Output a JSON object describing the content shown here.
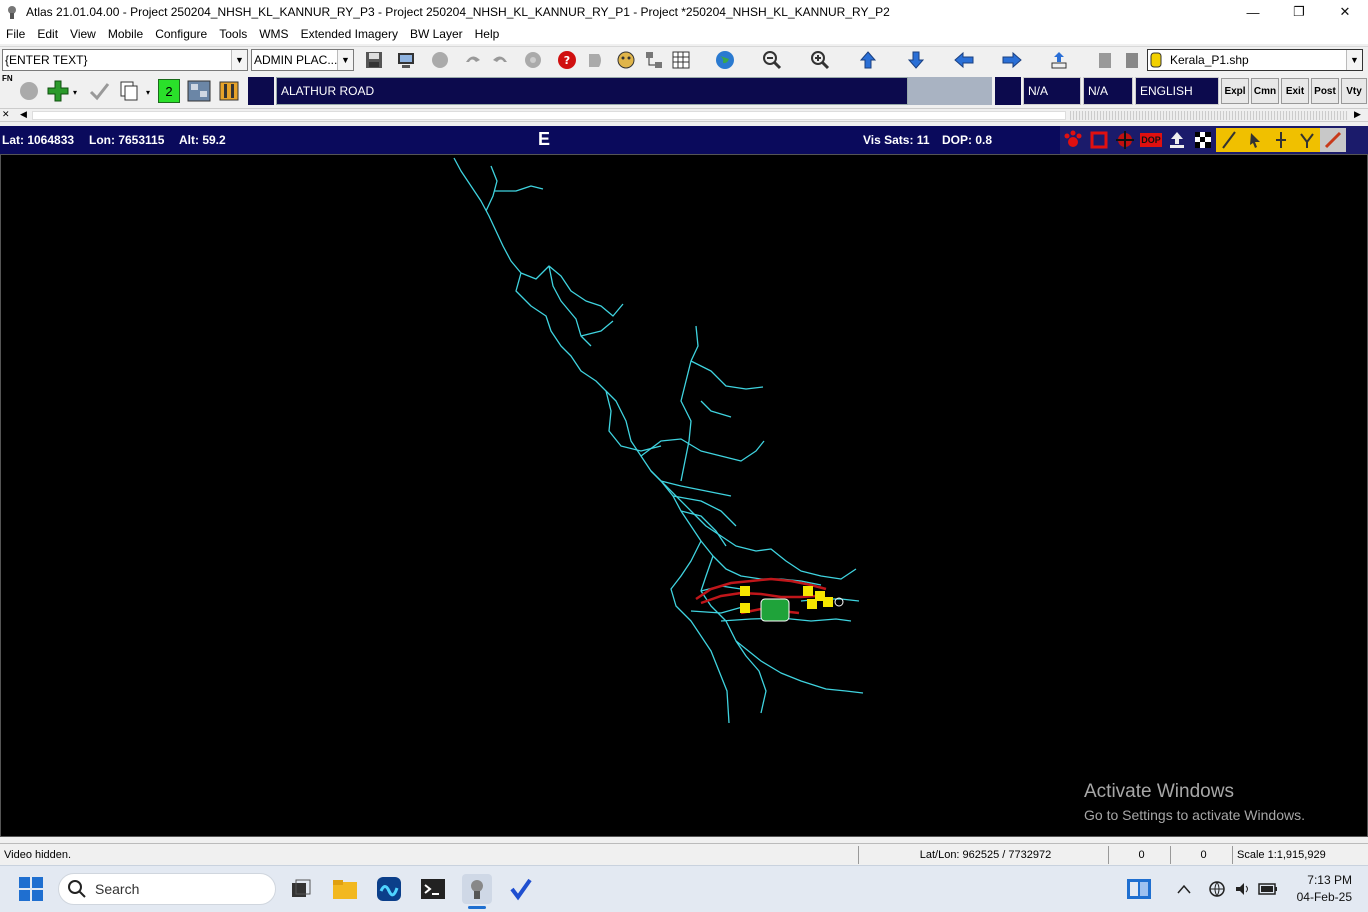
{
  "window": {
    "title": "Atlas 21.01.04.00 - Project 250204_NHSH_KL_KANNUR_RY_P3 - Project 250204_NHSH_KL_KANNUR_RY_P1 - Project *250204_NHSH_KL_KANNUR_RY_P2",
    "minimize": "—",
    "maximize": "❐",
    "close": "✕"
  },
  "menu": [
    "File",
    "Edit",
    "View",
    "Mobile",
    "Configure",
    "Tools",
    "WMS",
    "Extended Imagery",
    "BW Layer",
    "Help"
  ],
  "toolbar1": {
    "text_combo": "{ENTER TEXT}",
    "admin_combo": "ADMIN PLAC...",
    "layer_combo": "Kerala_P1.shp"
  },
  "toolbar2": {
    "fn_label": "FN",
    "count": "2",
    "road_name": "ALATHUR ROAD",
    "field_a": "N/A",
    "field_b": "N/A",
    "language": "ENGLISH",
    "buttons": [
      "Expl",
      "Cmn",
      "Exit",
      "Post",
      "Vty"
    ]
  },
  "gps": {
    "lat": "Lat: 1064833",
    "lon": "Lon: 7653115",
    "alt": "Alt: 59.2",
    "heading": "E",
    "vis_sats": "Vis Sats: 11",
    "dop": "DOP: 0.8",
    "dop_icon_label": "DOP"
  },
  "map": {
    "road_color": "#3fd3df",
    "track_color": "#c0161a",
    "marker_color": "#f5e600",
    "watermark_title": "Activate Windows",
    "watermark_sub": "Go to Settings to activate Windows."
  },
  "status": {
    "message": "Video hidden.",
    "latlon": "Lat/Lon: 962525 / 7732972",
    "val1": "0",
    "val2": "0",
    "scale": "Scale 1:1,915,929"
  },
  "taskbar": {
    "search_placeholder": "Search",
    "time": "7:13 PM",
    "date": "04-Feb-25"
  }
}
